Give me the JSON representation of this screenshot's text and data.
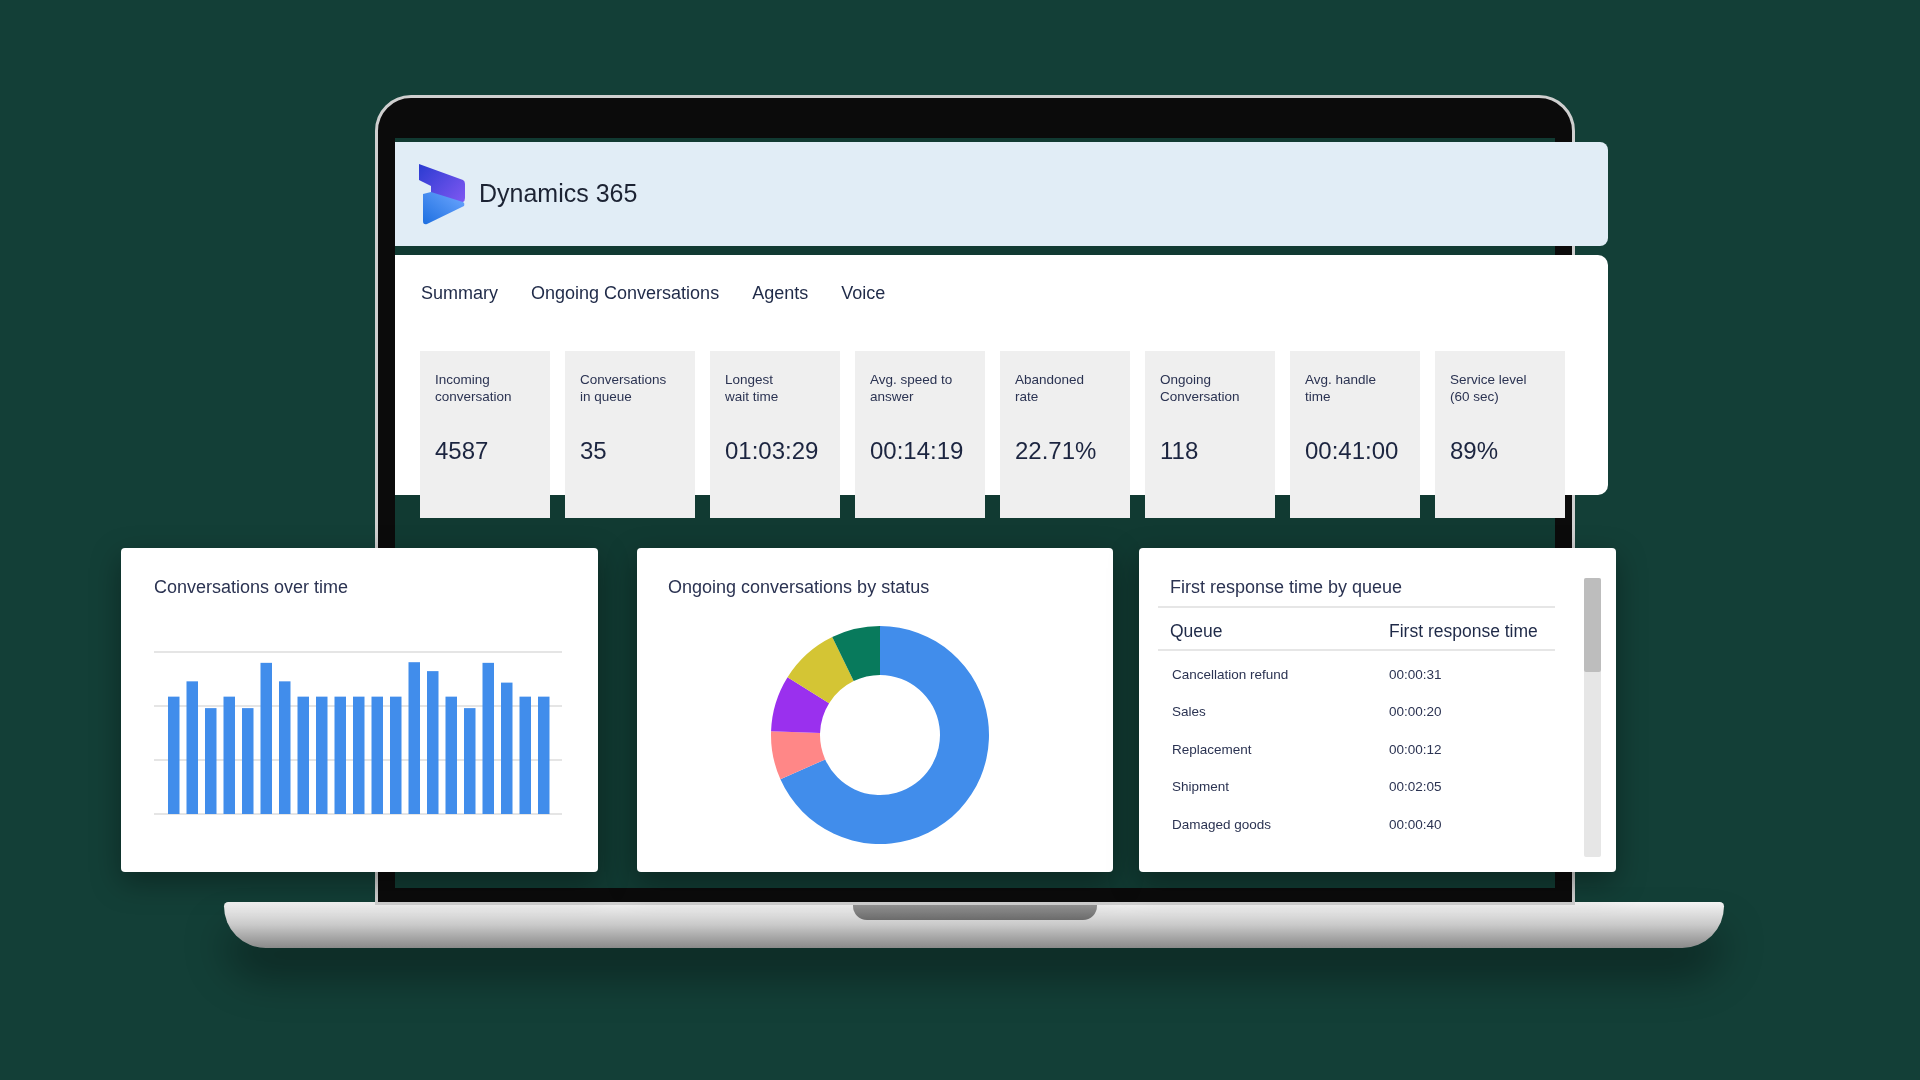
{
  "app": {
    "title": "Dynamics 365"
  },
  "tabs": [
    {
      "label": "Summary"
    },
    {
      "label": "Ongoing Conversations"
    },
    {
      "label": "Agents"
    },
    {
      "label": "Voice"
    }
  ],
  "kpis": [
    {
      "label": "Incoming\nconversation",
      "value": "4587"
    },
    {
      "label": "Conversations\nin queue",
      "value": "35"
    },
    {
      "label": "Longest\nwait time",
      "value": "01:03:29"
    },
    {
      "label": "Avg. speed to\nanswer",
      "value": "00:14:19"
    },
    {
      "label": "Abandoned\nrate",
      "value": "22.71%"
    },
    {
      "label": "Ongoing\nConversation",
      "value": "118"
    },
    {
      "label": "Avg. handle\ntime",
      "value": "00:41:00"
    },
    {
      "label": "Service level\n(60 sec)",
      "value": "89%"
    }
  ],
  "bar_panel": {
    "title": "Conversations over time"
  },
  "donut_panel": {
    "title": "Ongoing conversations by status"
  },
  "table_panel": {
    "title": "First response time by queue",
    "columns": [
      "Queue",
      "First response time"
    ],
    "rows": [
      [
        "Cancellation refund",
        "00:00:31"
      ],
      [
        "Sales",
        "00:00:20"
      ],
      [
        "Replacement",
        "00:00:12"
      ],
      [
        "Shipment",
        "00:02:05"
      ],
      [
        "Damaged goods",
        "00:00:40"
      ]
    ]
  }
}
